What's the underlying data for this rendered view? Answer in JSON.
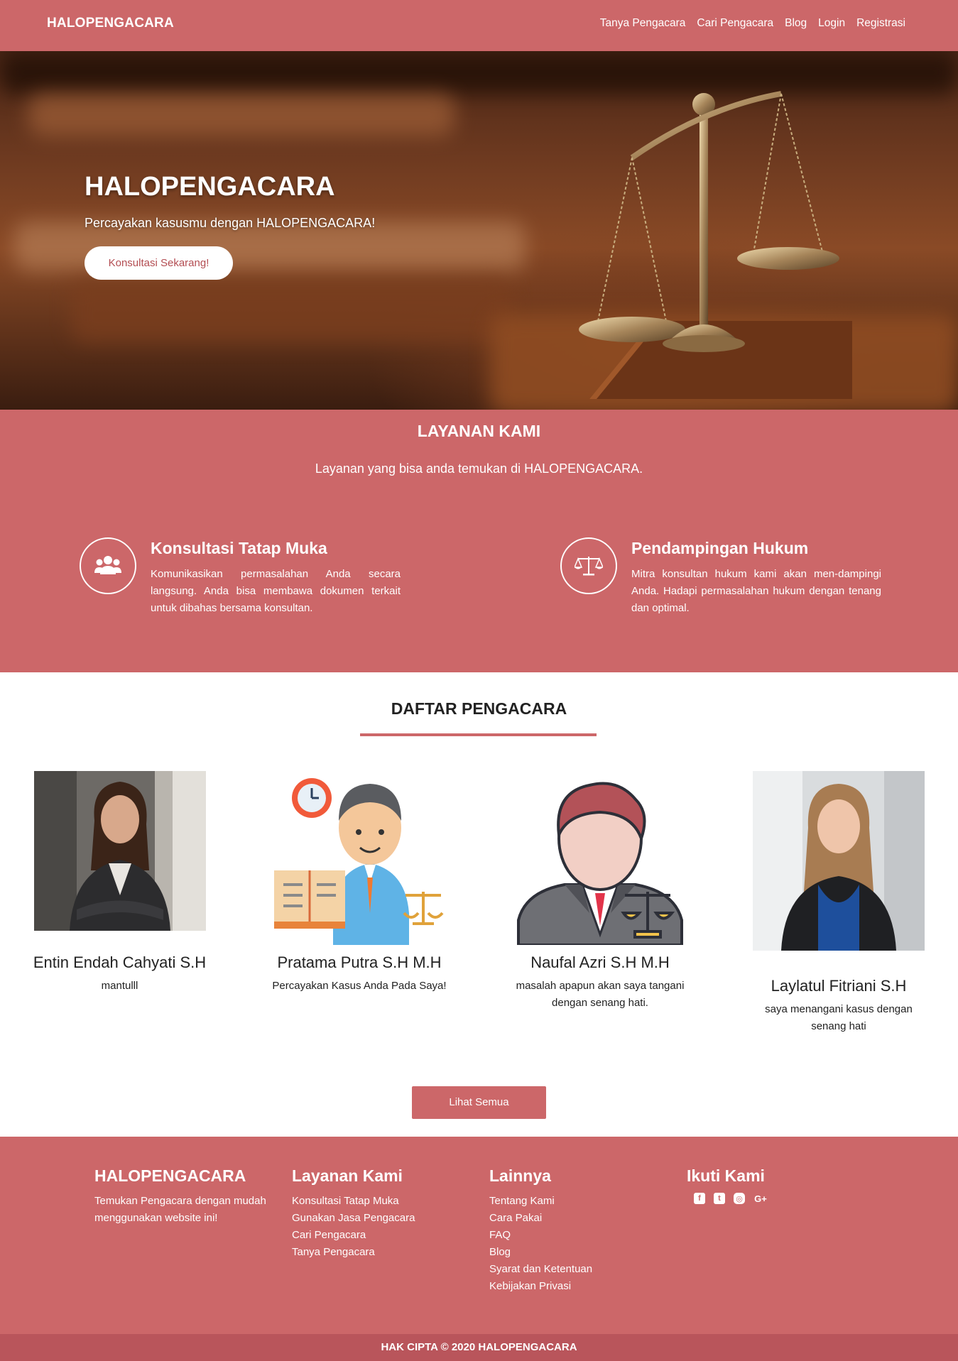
{
  "colors": {
    "primary": "#cc6769",
    "primary_dark": "#b9555b",
    "white": "#ffffff"
  },
  "navbar": {
    "brand": "HALOPENGACARA",
    "links": [
      "Tanya Pengacara",
      "Cari Pengacara",
      "Blog",
      "Login",
      "Registrasi"
    ]
  },
  "hero": {
    "title": "HALOPENGACARA",
    "subtitle": "Percayakan kasusmu dengan HALOPENGACARA!",
    "cta": "Konsultasi Sekarang!",
    "image_icon": "scale-of-justice-icon"
  },
  "services": {
    "title": "LAYANAN KAMI",
    "subtitle": "Layanan yang bisa anda temukan di HALOPENGACARA.",
    "items": [
      {
        "icon": "users-icon",
        "title": "Konsultasi Tatap Muka",
        "desc": "Komunikasikan permasalahan Anda secara langsung. Anda bisa membawa dokumen terkait untuk dibahas bersama konsultan."
      },
      {
        "icon": "balance-scale-icon",
        "title": "Pendampingan Hukum",
        "desc": "Mitra konsultan hukum kami akan men-dampingi Anda. Hadapi permasalahan hukum dengan tenang dan optimal."
      }
    ]
  },
  "lawyers": {
    "title": "DAFTAR PENGACARA",
    "items": [
      {
        "name": "Entin Endah Cahyati S.H",
        "desc": "mantulll",
        "avatar": "woman-photo"
      },
      {
        "name": "Pratama Putra S.H M.H",
        "desc": "Percayakan Kasus Anda Pada Saya!",
        "avatar": "lawyer-illustration"
      },
      {
        "name": "Naufal Azri S.H M.H",
        "desc": "masalah apapun akan saya tangani dengan senang hati.",
        "avatar": "lawyer-avatar"
      },
      {
        "name": "Laylatul Fitriani S.H",
        "desc": "saya menangani kasus dengan senang hati",
        "avatar": "woman-photo"
      }
    ],
    "see_all": "Lihat Semua"
  },
  "footer": {
    "about": {
      "title": "HALOPENGACARA",
      "text": "Temukan Pengacara dengan mudah menggunakan website ini!"
    },
    "services": {
      "title": "Layanan Kami",
      "links": [
        "Konsultasi Tatap Muka",
        "Gunakan Jasa Pengacara",
        "Cari Pengacara",
        "Tanya Pengacara"
      ]
    },
    "others": {
      "title": "Lainnya",
      "links": [
        "Tentang Kami",
        "Cara Pakai",
        "FAQ",
        "Blog",
        "Syarat dan Ketentuan",
        "Kebijakan Privasi"
      ]
    },
    "follow": {
      "title": "Ikuti Kami",
      "icons": [
        "facebook-icon",
        "twitter-icon",
        "instagram-icon",
        "google-plus-icon"
      ]
    },
    "copyright": "HAK CIPTA © 2020 HALOPENGACARA"
  }
}
